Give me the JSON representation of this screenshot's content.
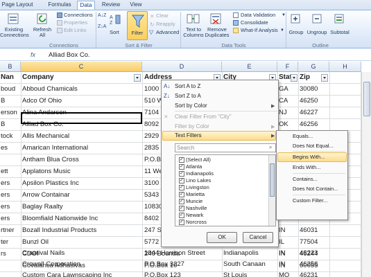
{
  "tabs": [
    "Page Layout",
    "Formulas",
    "Data",
    "Review",
    "View"
  ],
  "ribbon": {
    "connections": {
      "existing": [
        "Existing",
        "Connections"
      ],
      "refresh": [
        "Refresh",
        "All"
      ],
      "connections": "Connections",
      "properties": "Properties",
      "edit_links": "Edit Links",
      "group_label": "Connections"
    },
    "sort_filter": {
      "sort": "Sort",
      "filter": "Filter",
      "clear": "Clear",
      "reapply": "Reapply",
      "advanced": "Advanced",
      "group_label": "Sort & Filter"
    },
    "data_tools": {
      "text_to_columns": [
        "Text to",
        "Columns"
      ],
      "remove_duplicates": [
        "Remove",
        "Duplicates"
      ],
      "data_validation": "Data Validation",
      "consolidate": "Consolidate",
      "what_if": "What-If Analysis",
      "group_label": "Data Tools"
    },
    "outline": {
      "group": "Group",
      "ungroup": "Ungroup",
      "subtotal": "Subtotal",
      "group_label": "Outline"
    }
  },
  "formula_bar": {
    "fx": "fx",
    "value": "Alliad Box Co."
  },
  "columns": [
    "B",
    "C",
    "D",
    "E",
    "F",
    "G",
    "H"
  ],
  "header_row": {
    "b": "Nan",
    "company": "Company",
    "address": "Address",
    "city": "City",
    "state": "Stat",
    "zip": "Zip"
  },
  "rows": [
    {
      "b": "boud",
      "company": "Abboud Chamicals",
      "address": "1000 W. Oa",
      "city": "",
      "state": "GA",
      "zip": "30080"
    },
    {
      "b": "B",
      "company": "Adco Of Ohio",
      "address": "510 Wayne",
      "city": "",
      "state": "CA",
      "zip": "46250"
    },
    {
      "b": "erson",
      "company": "Alina Andarson",
      "address": "7104 U.S. H",
      "city": "",
      "state": "NJ",
      "zip": "46227"
    },
    {
      "b": "B",
      "company": "Alliad Box Co.",
      "address": "8092 Wood",
      "city": "",
      "state": "OK",
      "zip": "46256"
    },
    {
      "b": "tock",
      "company": "Allis Mechanical",
      "address": "2929 Bluff",
      "city": "",
      "state": "IN",
      "zip": "46225"
    },
    {
      "b": "es",
      "company": "Amarican International",
      "address": "2835 Pellis",
      "city": "",
      "state": "",
      "zip": ""
    },
    {
      "b": "",
      "company": "Antham Blua Cross",
      "address": "P.O.Box 79",
      "city": "",
      "state": "",
      "zip": ""
    },
    {
      "b": "ett",
      "company": "Applatons Music",
      "address": "11 West Ca",
      "city": "",
      "state": "",
      "zip": ""
    },
    {
      "b": "ers",
      "company": "Apsilon Plastics Inc",
      "address": "3100 E Ha",
      "city": "",
      "state": "",
      "zip": ""
    },
    {
      "b": "ers",
      "company": "Arrow Containar",
      "address": "5343 Comm",
      "city": "",
      "state": "",
      "zip": ""
    },
    {
      "b": "ers",
      "company": "Baglay Raalty",
      "address": "10830 And",
      "city": "",
      "state": "",
      "zip": ""
    },
    {
      "b": "ers",
      "company": "Bloomfiald Nationwide Inc",
      "address": "8402 N Ma",
      "city": "",
      "state": "",
      "zip": ""
    },
    {
      "b": "rtner",
      "company": "Bozall Industrial Products",
      "address": "247 S India",
      "city": "",
      "state": "IN",
      "zip": "46031"
    },
    {
      "b": "ter",
      "company": "Bunzl Oil",
      "address": "5772 Collec",
      "city": "",
      "state": "IL",
      "zip": "77504"
    },
    {
      "b": "rs",
      "company": "CDOI",
      "address": "240 Bounda",
      "city": "",
      "state": "IN",
      "zip": "46244"
    },
    {
      "b": "",
      "company": "Covalanca Adhasivas",
      "address": "P.O.Box 10",
      "city": "",
      "state": "IN",
      "zip": "60055"
    },
    {
      "b": "",
      "company": "Craatival Nails",
      "address": "1044 Harrison Street",
      "city": "Indianapolis",
      "state": "IN",
      "zip": "46223"
    },
    {
      "b": "",
      "company": "Crowall Corporation",
      "address": "P.O.Box 3227",
      "city": "South Canaan",
      "state": "IN",
      "zip": "46256"
    },
    {
      "b": "",
      "company": "Custom Cara Lawnscaping Inc",
      "address": "P.O.Box 123",
      "city": "St Louis",
      "state": "MO",
      "zip": "46231"
    }
  ],
  "filter_menu": {
    "sort_az": "Sort A to Z",
    "sort_za": "Sort Z to A",
    "sort_color": "Sort by Color",
    "clear_filter": "Clear Filter From \"City\"",
    "filter_color": "Filter by Color",
    "text_filters": "Text Filters",
    "search_placeholder": "Search",
    "items": [
      "(Select All)",
      "Atlanta",
      "Indianapolis",
      "Lino Lakes",
      "Livingston",
      "Marietta",
      "Muncie",
      "Nashville",
      "Newark",
      "Norcross"
    ],
    "ok": "OK",
    "cancel": "Cancel"
  },
  "text_filters_menu": {
    "items": [
      "Equals...",
      "Does Not Equal...",
      "Begins With...",
      "Ends With...",
      "Contains...",
      "Does Not Contain...",
      "Custom Filter..."
    ],
    "highlighted": "Begins With..."
  },
  "colors": {
    "accent": "#15428b",
    "highlight": "#fddc8a",
    "ribbon": "#e3edfa"
  }
}
